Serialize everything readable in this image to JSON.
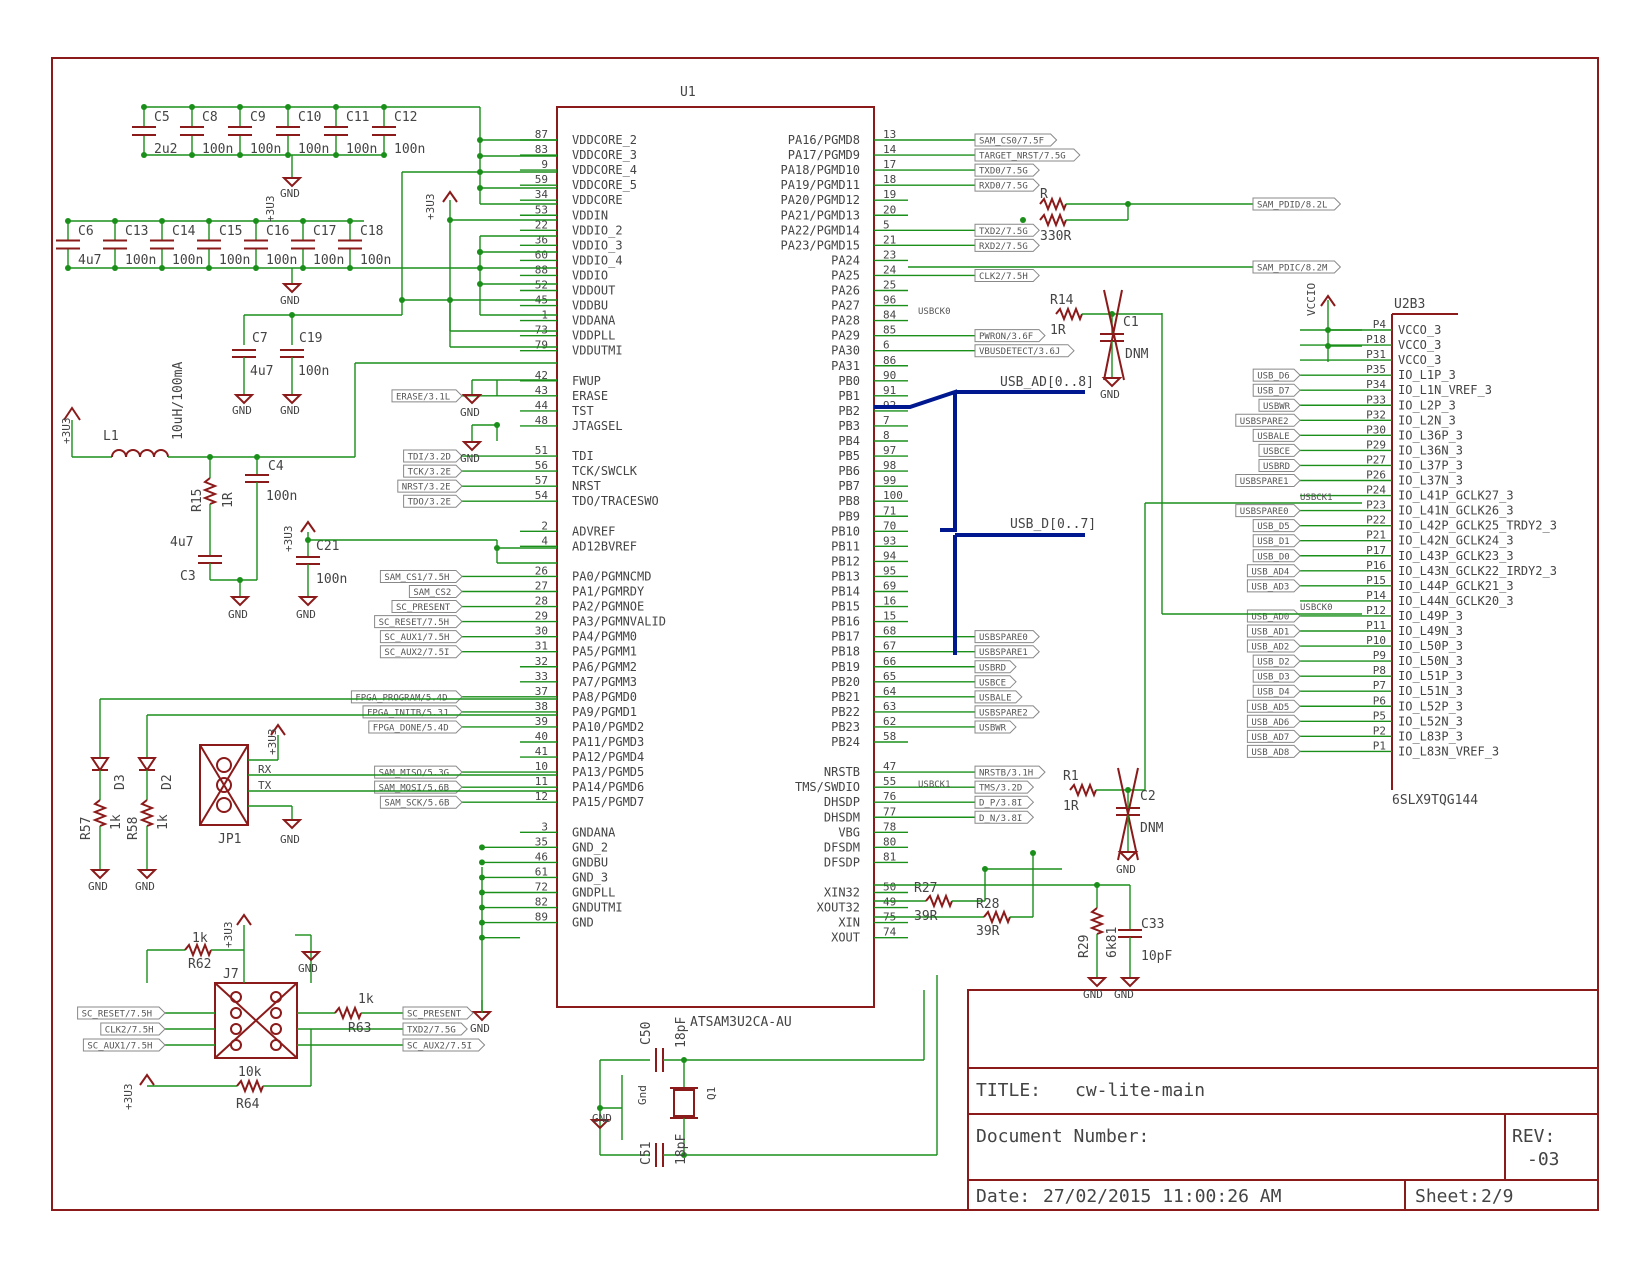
{
  "u1": {
    "ref": "U1",
    "value": "ATSAM3U2CA-AU",
    "left_pins": [
      {
        "num": "87",
        "name": "VDDCORE_2"
      },
      {
        "num": "83",
        "name": "VDDCORE_3"
      },
      {
        "num": "9",
        "name": "VDDCORE_4"
      },
      {
        "num": "59",
        "name": "VDDCORE_5"
      },
      {
        "num": "34",
        "name": "VDDCORE"
      },
      {
        "num": "53",
        "name": "VDDIN"
      },
      {
        "num": "22",
        "name": "VDDIO_2"
      },
      {
        "num": "36",
        "name": "VDDIO_3"
      },
      {
        "num": "60",
        "name": "VDDIO_4"
      },
      {
        "num": "88",
        "name": "VDDIO"
      },
      {
        "num": "52",
        "name": "VDDOUT"
      },
      {
        "num": "45",
        "name": "VDDBU"
      },
      {
        "num": "1",
        "name": "VDDANA"
      },
      {
        "num": "73",
        "name": "VDDPLL"
      },
      {
        "num": "79",
        "name": "VDDUTMI"
      },
      {
        "num": "",
        "name": ""
      },
      {
        "num": "42",
        "name": "FWUP"
      },
      {
        "num": "43",
        "name": "ERASE"
      },
      {
        "num": "44",
        "name": "TST"
      },
      {
        "num": "48",
        "name": "JTAGSEL"
      },
      {
        "num": "",
        "name": ""
      },
      {
        "num": "51",
        "name": "TDI"
      },
      {
        "num": "56",
        "name": "TCK/SWCLK"
      },
      {
        "num": "57",
        "name": "NRST"
      },
      {
        "num": "54",
        "name": "TDO/TRACESWO"
      },
      {
        "num": "",
        "name": ""
      },
      {
        "num": "2",
        "name": "ADVREF"
      },
      {
        "num": "4",
        "name": "AD12BVREF"
      },
      {
        "num": "",
        "name": ""
      },
      {
        "num": "26",
        "name": "PA0/PGMNCMD"
      },
      {
        "num": "27",
        "name": "PA1/PGMRDY"
      },
      {
        "num": "28",
        "name": "PA2/PGMNOE"
      },
      {
        "num": "29",
        "name": "PA3/PGMNVALID"
      },
      {
        "num": "30",
        "name": "PA4/PGMM0"
      },
      {
        "num": "31",
        "name": "PA5/PGMM1"
      },
      {
        "num": "32",
        "name": "PA6/PGMM2"
      },
      {
        "num": "33",
        "name": "PA7/PGMM3"
      },
      {
        "num": "37",
        "name": "PA8/PGMD0"
      },
      {
        "num": "38",
        "name": "PA9/PGMD1"
      },
      {
        "num": "39",
        "name": "PA10/PGMD2"
      },
      {
        "num": "40",
        "name": "PA11/PGMD3"
      },
      {
        "num": "41",
        "name": "PA12/PGMD4"
      },
      {
        "num": "10",
        "name": "PA13/PGMD5"
      },
      {
        "num": "11",
        "name": "PA14/PGMD6"
      },
      {
        "num": "12",
        "name": "PA15/PGMD7"
      },
      {
        "num": "",
        "name": ""
      },
      {
        "num": "3",
        "name": "GNDANA"
      },
      {
        "num": "35",
        "name": "GND_2"
      },
      {
        "num": "46",
        "name": "GNDBU"
      },
      {
        "num": "61",
        "name": "GND_3"
      },
      {
        "num": "72",
        "name": "GNDPLL"
      },
      {
        "num": "82",
        "name": "GNDUTMI"
      },
      {
        "num": "89",
        "name": "GND"
      }
    ],
    "right_pins": [
      {
        "num": "13",
        "name": "PA16/PGMD8"
      },
      {
        "num": "14",
        "name": "PA17/PGMD9"
      },
      {
        "num": "17",
        "name": "PA18/PGMD10"
      },
      {
        "num": "18",
        "name": "PA19/PGMD11"
      },
      {
        "num": "19",
        "name": "PA20/PGMD12"
      },
      {
        "num": "20",
        "name": "PA21/PGMD13"
      },
      {
        "num": "5",
        "name": "PA22/PGMD14"
      },
      {
        "num": "21",
        "name": "PA23/PGMD15"
      },
      {
        "num": "23",
        "name": "PA24"
      },
      {
        "num": "24",
        "name": "PA25"
      },
      {
        "num": "25",
        "name": "PA26"
      },
      {
        "num": "96",
        "name": "PA27"
      },
      {
        "num": "84",
        "name": "PA28"
      },
      {
        "num": "85",
        "name": "PA29"
      },
      {
        "num": "6",
        "name": "PA30"
      },
      {
        "num": "86",
        "name": "PA31"
      },
      {
        "num": "90",
        "name": "PB0"
      },
      {
        "num": "91",
        "name": "PB1"
      },
      {
        "num": "92",
        "name": "PB2"
      },
      {
        "num": "7",
        "name": "PB3"
      },
      {
        "num": "8",
        "name": "PB4"
      },
      {
        "num": "97",
        "name": "PB5"
      },
      {
        "num": "98",
        "name": "PB6"
      },
      {
        "num": "99",
        "name": "PB7"
      },
      {
        "num": "100",
        "name": "PB8"
      },
      {
        "num": "71",
        "name": "PB9"
      },
      {
        "num": "70",
        "name": "PB10"
      },
      {
        "num": "93",
        "name": "PB11"
      },
      {
        "num": "94",
        "name": "PB12"
      },
      {
        "num": "95",
        "name": "PB13"
      },
      {
        "num": "69",
        "name": "PB14"
      },
      {
        "num": "16",
        "name": "PB15"
      },
      {
        "num": "15",
        "name": "PB16"
      },
      {
        "num": "68",
        "name": "PB17"
      },
      {
        "num": "67",
        "name": "PB18"
      },
      {
        "num": "66",
        "name": "PB19"
      },
      {
        "num": "65",
        "name": "PB20"
      },
      {
        "num": "64",
        "name": "PB21"
      },
      {
        "num": "63",
        "name": "PB22"
      },
      {
        "num": "62",
        "name": "PB23"
      },
      {
        "num": "58",
        "name": "PB24"
      },
      {
        "num": "",
        "name": ""
      },
      {
        "num": "47",
        "name": "NRSTB"
      },
      {
        "num": "55",
        "name": "TMS/SWDIO"
      },
      {
        "num": "76",
        "name": "DHSDP"
      },
      {
        "num": "77",
        "name": "DHSDM"
      },
      {
        "num": "78",
        "name": "VBG"
      },
      {
        "num": "80",
        "name": "DFSDM"
      },
      {
        "num": "81",
        "name": "DFSDP"
      },
      {
        "num": "",
        "name": ""
      },
      {
        "num": "50",
        "name": "XIN32"
      },
      {
        "num": "49",
        "name": "XOUT32"
      },
      {
        "num": "75",
        "name": "XIN"
      },
      {
        "num": "74",
        "name": "XOUT"
      }
    ],
    "right_flags": [
      {
        "row": 0,
        "text": "SAM_CS0/7.5F"
      },
      {
        "row": 1,
        "text": "TARGET_NRST/7.5G"
      },
      {
        "row": 2,
        "text": "TXD0/7.5G"
      },
      {
        "row": 3,
        "text": "RXD0/7.5G"
      },
      {
        "row": 6,
        "text": "TXD2/7.5G"
      },
      {
        "row": 7,
        "text": "RXD2/7.5G"
      },
      {
        "row": 9,
        "text": "CLK2/7.5H"
      },
      {
        "row": 13,
        "text": "PWRON/3.6F"
      },
      {
        "row": 14,
        "text": "VBUSDETECT/3.6J"
      },
      {
        "row": 33,
        "text": "USBSPARE0"
      },
      {
        "row": 34,
        "text": "USBSPARE1"
      },
      {
        "row": 35,
        "text": "USBRD"
      },
      {
        "row": 36,
        "text": "USBCE"
      },
      {
        "row": 37,
        "text": "USBALE"
      },
      {
        "row": 38,
        "text": "USBSPARE2"
      },
      {
        "row": 39,
        "text": "USBWR"
      },
      {
        "row": 42,
        "text": "NRSTB/3.1H"
      },
      {
        "row": 43,
        "text": "TMS/3.2D"
      },
      {
        "row": 44,
        "text": "D_P/3.8I"
      },
      {
        "row": 45,
        "text": "D_N/3.8I"
      }
    ],
    "left_flags": [
      {
        "row": 17,
        "text": "ERASE/3.1L"
      },
      {
        "row": 21,
        "text": "TDI/3.2D"
      },
      {
        "row": 22,
        "text": "TCK/3.2E"
      },
      {
        "row": 23,
        "text": "NRST/3.2E"
      },
      {
        "row": 24,
        "text": "TDO/3.2E"
      },
      {
        "row": 29,
        "text": "SAM_CS1/7.5H"
      },
      {
        "row": 30,
        "text": "SAM_CS2"
      },
      {
        "row": 31,
        "text": "SC_PRESENT"
      },
      {
        "row": 32,
        "text": "SC_RESET/7.5H"
      },
      {
        "row": 33,
        "text": "SC_AUX1/7.5H"
      },
      {
        "row": 34,
        "text": "SC_AUX2/7.5I"
      },
      {
        "row": 37,
        "text": "FPGA_PROGRAM/5.4D"
      },
      {
        "row": 38,
        "text": "FPGA_INITB/5.3J"
      },
      {
        "row": 39,
        "text": "FPGA_DONE/5.4D"
      },
      {
        "row": 42,
        "text": "SAM_MISO/5.3G"
      },
      {
        "row": 43,
        "text": "SAM_MOSI/5.6B"
      },
      {
        "row": 44,
        "text": "SAM_SCK/5.6B"
      }
    ]
  },
  "u2": {
    "ref": "U2B3",
    "value": "6SLX9TQG144",
    "supply": "VCCIO",
    "pins": [
      {
        "num": "P4",
        "name": "VCCO_3",
        "flag": ""
      },
      {
        "num": "P18",
        "name": "VCCO_3",
        "flag": ""
      },
      {
        "num": "P31",
        "name": "VCCO_3",
        "flag": ""
      },
      {
        "num": "P35",
        "name": "IO_L1P_3",
        "flag": "USB_D6"
      },
      {
        "num": "P34",
        "name": "IO_L1N_VREF_3",
        "flag": "USB_D7"
      },
      {
        "num": "P33",
        "name": "IO_L2P_3",
        "flag": "USBWR"
      },
      {
        "num": "P32",
        "name": "IO_L2N_3",
        "flag": "USBSPARE2"
      },
      {
        "num": "P30",
        "name": "IO_L36P_3",
        "flag": "USBALE"
      },
      {
        "num": "P29",
        "name": "IO_L36N_3",
        "flag": "USBCE"
      },
      {
        "num": "P27",
        "name": "IO_L37P_3",
        "flag": "USBRD"
      },
      {
        "num": "P26",
        "name": "IO_L37N_3",
        "flag": "USBSPARE1"
      },
      {
        "num": "P24",
        "name": "IO_L41P_GCLK27_3",
        "flag": ""
      },
      {
        "num": "P23",
        "name": "IO_L41N_GCLK26_3",
        "flag": "USBSPARE0"
      },
      {
        "num": "P22",
        "name": "IO_L42P_GCLK25_TRDY2_3",
        "flag": "USB_D5"
      },
      {
        "num": "P21",
        "name": "IO_L42N_GCLK24_3",
        "flag": "USB_D1"
      },
      {
        "num": "P17",
        "name": "IO_L43P_GCLK23_3",
        "flag": "USB_D0"
      },
      {
        "num": "P16",
        "name": "IO_L43N_GCLK22_IRDY2_3",
        "flag": "USB_AD4"
      },
      {
        "num": "P15",
        "name": "IO_L44P_GCLK21_3",
        "flag": "USB_AD3"
      },
      {
        "num": "P14",
        "name": "IO_L44N_GCLK20_3",
        "flag": ""
      },
      {
        "num": "P12",
        "name": "IO_L49P_3",
        "flag": "USB_AD0"
      },
      {
        "num": "P11",
        "name": "IO_L49N_3",
        "flag": "USB_AD1"
      },
      {
        "num": "P10",
        "name": "IO_L50P_3",
        "flag": "USB_AD2"
      },
      {
        "num": "P9",
        "name": "IO_L50N_3",
        "flag": "USB_D2"
      },
      {
        "num": "P8",
        "name": "IO_L51P_3",
        "flag": "USB_D3"
      },
      {
        "num": "P7",
        "name": "IO_L51N_3",
        "flag": "USB_D4"
      },
      {
        "num": "P6",
        "name": "IO_L52P_3",
        "flag": "USB_AD5"
      },
      {
        "num": "P5",
        "name": "IO_L52N_3",
        "flag": "USB_AD6"
      },
      {
        "num": "P2",
        "name": "IO_L83P_3",
        "flag": "USB_AD7"
      },
      {
        "num": "P1",
        "name": "IO_L83N_VREF_3",
        "flag": "USB_AD8"
      }
    ],
    "net_usbck1": "USBCK1",
    "net_usbck0": "USBCK0"
  },
  "caps_top": {
    "refs": [
      "C5",
      "C8",
      "C9",
      "C10",
      "C11",
      "C12"
    ],
    "values": [
      "2u2",
      "100n",
      "100n",
      "100n",
      "100n",
      "100n"
    ]
  },
  "caps_mid": {
    "refs": [
      "C6",
      "C13",
      "C14",
      "C15",
      "C16",
      "C17",
      "C18"
    ],
    "values": [
      "4u7",
      "100n",
      "100n",
      "100n",
      "100n",
      "100n",
      "100n"
    ]
  },
  "caps_pwr": {
    "c7": "C7",
    "c7v": "4u7",
    "c19": "C19",
    "c19v": "100n"
  },
  "nets": {
    "gnd": "GND",
    "v3": "+3U3",
    "sam_pdid": "SAM_PDID/8.2L",
    "sam_pdic": "SAM_PDIC/8.2M",
    "usb_ad": "USB_AD[0..8]",
    "usb_d": "USB_D[0..7]",
    "usbck0": "USBCK0",
    "usbck1": "USBCK1",
    "rx": "RX",
    "tx": "TX"
  },
  "parts": {
    "r": "R",
    "r_val": "330R",
    "r14": "R14",
    "r14v": "1R",
    "c1": "C1",
    "c1v": "DNM",
    "r1": "R1",
    "r1v": "1R",
    "c2": "C2",
    "c2v": "DNM",
    "r27": "R27",
    "r27v": "39R",
    "r28": "R28",
    "r28v": "39R",
    "r29": "R29",
    "r29v": "6k81",
    "c33": "C33",
    "c33v": "10pF",
    "l1": "L1",
    "l1v": "10uH/100mA",
    "r15": "R15",
    "r15v": "1R",
    "c4": "C4",
    "c4v": "100n",
    "c3": "C3",
    "c3v": "4u7",
    "c21": "C21",
    "c21v": "100n",
    "d3": "D3",
    "d2": "D2",
    "r57": "R57",
    "r57v": "1k",
    "r58": "R58",
    "r58v": "1k",
    "jp1": "JP1",
    "j7": "J7",
    "r62": "R62",
    "r62v": "1k",
    "r63": "R63",
    "r63v": "1k",
    "r64": "R64",
    "r64v": "10k",
    "c50": "C50",
    "c50v": "18pF",
    "c51": "C51",
    "c51v": "18pF",
    "q1": "Q1",
    "gndlbl": "Gnd"
  },
  "j7_flags": {
    "left": [
      "SC_RESET/7.5H",
      "CLK2/7.5H",
      "SC_AUX1/7.5H"
    ],
    "right": [
      "SC_PRESENT",
      "TXD2/7.5G",
      "SC_AUX2/7.5I"
    ]
  },
  "title_block": {
    "title_label": "TITLE:",
    "title": "cw-lite-main",
    "docnum_label": "Document Number:",
    "rev_label": "REV:",
    "rev": "-03",
    "date_label": "Date:",
    "date": "27/02/2015 11:00:26 AM",
    "sheet_label": "Sheet:",
    "sheet": "2/9"
  }
}
